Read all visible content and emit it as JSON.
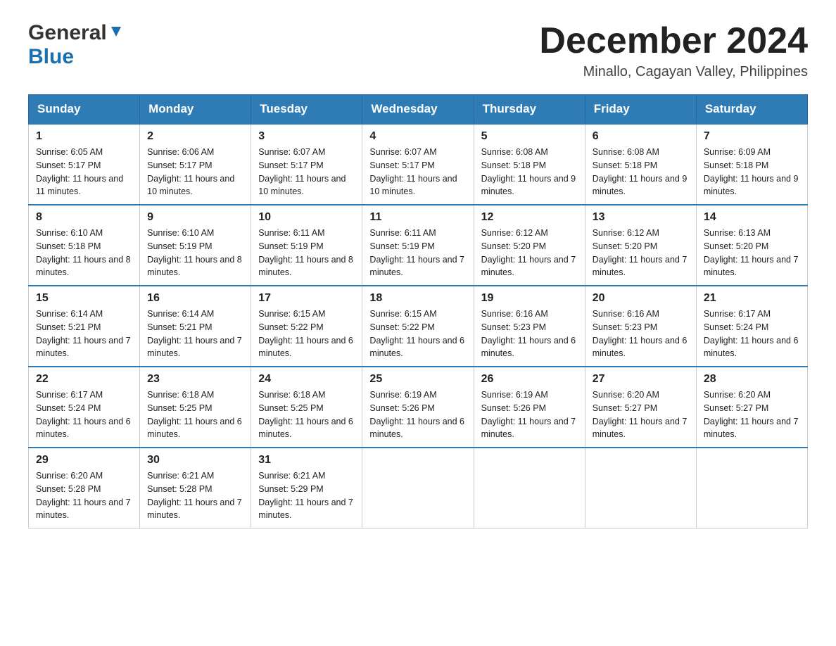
{
  "header": {
    "logo_general": "General",
    "logo_blue": "Blue",
    "month_title": "December 2024",
    "subtitle": "Minallo, Cagayan Valley, Philippines"
  },
  "weekdays": [
    "Sunday",
    "Monday",
    "Tuesday",
    "Wednesday",
    "Thursday",
    "Friday",
    "Saturday"
  ],
  "weeks": [
    [
      {
        "day": "1",
        "sunrise": "6:05 AM",
        "sunset": "5:17 PM",
        "daylight": "11 hours and 11 minutes."
      },
      {
        "day": "2",
        "sunrise": "6:06 AM",
        "sunset": "5:17 PM",
        "daylight": "11 hours and 10 minutes."
      },
      {
        "day": "3",
        "sunrise": "6:07 AM",
        "sunset": "5:17 PM",
        "daylight": "11 hours and 10 minutes."
      },
      {
        "day": "4",
        "sunrise": "6:07 AM",
        "sunset": "5:17 PM",
        "daylight": "11 hours and 10 minutes."
      },
      {
        "day": "5",
        "sunrise": "6:08 AM",
        "sunset": "5:18 PM",
        "daylight": "11 hours and 9 minutes."
      },
      {
        "day": "6",
        "sunrise": "6:08 AM",
        "sunset": "5:18 PM",
        "daylight": "11 hours and 9 minutes."
      },
      {
        "day": "7",
        "sunrise": "6:09 AM",
        "sunset": "5:18 PM",
        "daylight": "11 hours and 9 minutes."
      }
    ],
    [
      {
        "day": "8",
        "sunrise": "6:10 AM",
        "sunset": "5:18 PM",
        "daylight": "11 hours and 8 minutes."
      },
      {
        "day": "9",
        "sunrise": "6:10 AM",
        "sunset": "5:19 PM",
        "daylight": "11 hours and 8 minutes."
      },
      {
        "day": "10",
        "sunrise": "6:11 AM",
        "sunset": "5:19 PM",
        "daylight": "11 hours and 8 minutes."
      },
      {
        "day": "11",
        "sunrise": "6:11 AM",
        "sunset": "5:19 PM",
        "daylight": "11 hours and 7 minutes."
      },
      {
        "day": "12",
        "sunrise": "6:12 AM",
        "sunset": "5:20 PM",
        "daylight": "11 hours and 7 minutes."
      },
      {
        "day": "13",
        "sunrise": "6:12 AM",
        "sunset": "5:20 PM",
        "daylight": "11 hours and 7 minutes."
      },
      {
        "day": "14",
        "sunrise": "6:13 AM",
        "sunset": "5:20 PM",
        "daylight": "11 hours and 7 minutes."
      }
    ],
    [
      {
        "day": "15",
        "sunrise": "6:14 AM",
        "sunset": "5:21 PM",
        "daylight": "11 hours and 7 minutes."
      },
      {
        "day": "16",
        "sunrise": "6:14 AM",
        "sunset": "5:21 PM",
        "daylight": "11 hours and 7 minutes."
      },
      {
        "day": "17",
        "sunrise": "6:15 AM",
        "sunset": "5:22 PM",
        "daylight": "11 hours and 6 minutes."
      },
      {
        "day": "18",
        "sunrise": "6:15 AM",
        "sunset": "5:22 PM",
        "daylight": "11 hours and 6 minutes."
      },
      {
        "day": "19",
        "sunrise": "6:16 AM",
        "sunset": "5:23 PM",
        "daylight": "11 hours and 6 minutes."
      },
      {
        "day": "20",
        "sunrise": "6:16 AM",
        "sunset": "5:23 PM",
        "daylight": "11 hours and 6 minutes."
      },
      {
        "day": "21",
        "sunrise": "6:17 AM",
        "sunset": "5:24 PM",
        "daylight": "11 hours and 6 minutes."
      }
    ],
    [
      {
        "day": "22",
        "sunrise": "6:17 AM",
        "sunset": "5:24 PM",
        "daylight": "11 hours and 6 minutes."
      },
      {
        "day": "23",
        "sunrise": "6:18 AM",
        "sunset": "5:25 PM",
        "daylight": "11 hours and 6 minutes."
      },
      {
        "day": "24",
        "sunrise": "6:18 AM",
        "sunset": "5:25 PM",
        "daylight": "11 hours and 6 minutes."
      },
      {
        "day": "25",
        "sunrise": "6:19 AM",
        "sunset": "5:26 PM",
        "daylight": "11 hours and 6 minutes."
      },
      {
        "day": "26",
        "sunrise": "6:19 AM",
        "sunset": "5:26 PM",
        "daylight": "11 hours and 7 minutes."
      },
      {
        "day": "27",
        "sunrise": "6:20 AM",
        "sunset": "5:27 PM",
        "daylight": "11 hours and 7 minutes."
      },
      {
        "day": "28",
        "sunrise": "6:20 AM",
        "sunset": "5:27 PM",
        "daylight": "11 hours and 7 minutes."
      }
    ],
    [
      {
        "day": "29",
        "sunrise": "6:20 AM",
        "sunset": "5:28 PM",
        "daylight": "11 hours and 7 minutes."
      },
      {
        "day": "30",
        "sunrise": "6:21 AM",
        "sunset": "5:28 PM",
        "daylight": "11 hours and 7 minutes."
      },
      {
        "day": "31",
        "sunrise": "6:21 AM",
        "sunset": "5:29 PM",
        "daylight": "11 hours and 7 minutes."
      },
      null,
      null,
      null,
      null
    ]
  ],
  "labels": {
    "sunrise_prefix": "Sunrise: ",
    "sunset_prefix": "Sunset: ",
    "daylight_prefix": "Daylight: "
  }
}
